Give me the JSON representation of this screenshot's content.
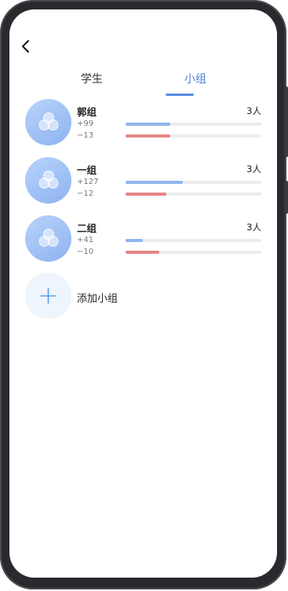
{
  "tabs": [
    {
      "label": "学生",
      "active": false
    },
    {
      "label": "小组",
      "active": true
    }
  ],
  "groups": [
    {
      "name": "郭组",
      "positive": "+99",
      "negative": "−13",
      "count": "3人",
      "positive_fill": 0.33,
      "negative_fill": 0.33
    },
    {
      "name": "一组",
      "positive": "+127",
      "negative": "−12",
      "count": "3人",
      "positive_fill": 0.42,
      "negative_fill": 0.3
    },
    {
      "name": "二组",
      "positive": "+41",
      "negative": "−10",
      "count": "3人",
      "positive_fill": 0.13,
      "negative_fill": 0.25
    }
  ],
  "add_group_label": "添加小组",
  "colors": {
    "accent": "#5b8ddf",
    "positive_bar": "#8fb6ee",
    "negative_bar": "#e58686",
    "avatar_gradient_start": "#b8d4fb",
    "avatar_gradient_end": "#8eb2f0"
  },
  "icons": {
    "back": "chevron-left-icon",
    "group_avatar": "group-circles-icon",
    "add": "plus-icon"
  }
}
